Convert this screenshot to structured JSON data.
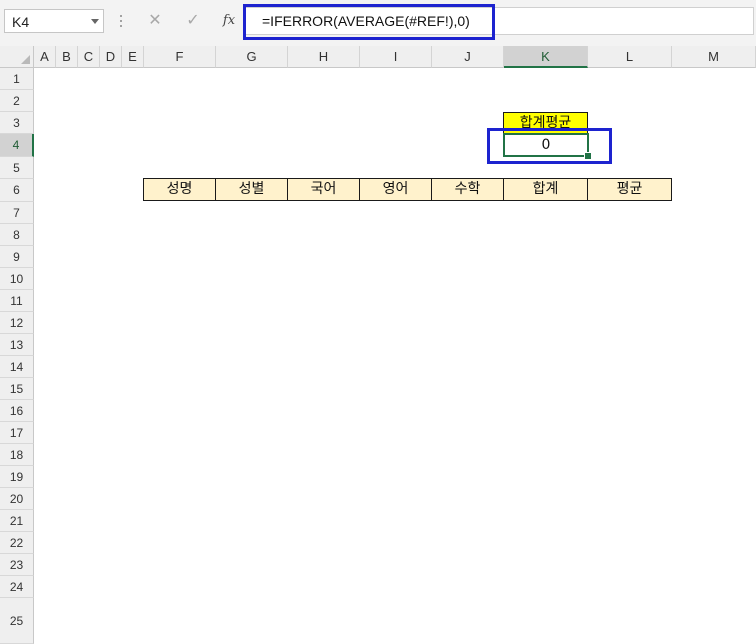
{
  "name_box": {
    "value": "K4"
  },
  "formula_bar": {
    "cancel_icon": "close-icon",
    "enter_icon": "check-icon",
    "fx_label": "fx",
    "formula": "=IFERROR(AVERAGE(#REF!),0)"
  },
  "columns": [
    "A",
    "B",
    "C",
    "D",
    "E",
    "F",
    "G",
    "H",
    "I",
    "J",
    "K",
    "L",
    "M"
  ],
  "rows": [
    "1",
    "2",
    "3",
    "4",
    "5",
    "6",
    "7",
    "8",
    "9",
    "10",
    "11",
    "12",
    "13",
    "14",
    "15",
    "16",
    "17",
    "18",
    "19",
    "20",
    "21",
    "22",
    "23",
    "24",
    "25"
  ],
  "active": {
    "column": "K",
    "row": "4"
  },
  "cells": {
    "k3_label": "합계평균",
    "k4_value": "0",
    "header_row": [
      "성명",
      "성별",
      "국어",
      "영어",
      "수학",
      "합계",
      "평균"
    ]
  },
  "colors": {
    "highlight_border": "#1d23cf",
    "header_fill": "#fff2cc",
    "label_fill": "#ffff00",
    "selection": "#217346"
  }
}
